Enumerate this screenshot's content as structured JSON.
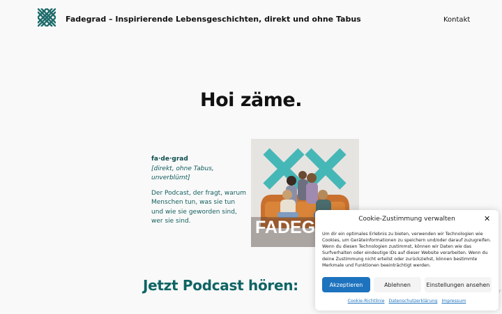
{
  "header": {
    "site_title": "Fadegrad – Inspirierende Lebensgeschichten, direkt und ohne Tabus",
    "nav_contact": "Kontakt",
    "logo_icon": "crosshatch-logo-icon"
  },
  "hero": {
    "title": "Hoi zäme."
  },
  "definition": {
    "word": "fa·de·grad",
    "meaning": "[direkt, ohne Tabus, unverblümt]",
    "description": "Der Podcast, der fragt, warum Menschen tun, was sie tun und wie sie geworden sind, wer sie sind."
  },
  "cover": {
    "text": "FADEG",
    "accent_color": "#2fb5b5"
  },
  "podcast": {
    "title": "Jetzt Podcast hören:"
  },
  "cookie": {
    "title": "Cookie-Zustimmung verwalten",
    "close_icon": "close-icon",
    "text": "Um dir ein optimales Erlebnis zu bieten, verwenden wir Technologien wie Cookies, um Geräteinformationen zu speichern und/oder darauf zuzugreifen. Wenn du diesen Technologien zustimmst, können wir Daten wie das Surfverhalten oder eindeutige IDs auf dieser Website verarbeiten. Wenn du deine Zustimmung nicht erteilst oder zurückziehst, können bestimmte Merkmale und Funktionen beeinträchtigt werden.",
    "accept_label": "Akzeptieren",
    "deny_label": "Ablehnen",
    "settings_label": "Einstellungen ansehen",
    "links": [
      "Cookie-Richtlinie",
      "Datenschutzerklärung",
      "Impressum"
    ],
    "accent_color": "#1e73be"
  },
  "colors": {
    "teal": "#0f6464",
    "background": "#f9f9f9"
  }
}
